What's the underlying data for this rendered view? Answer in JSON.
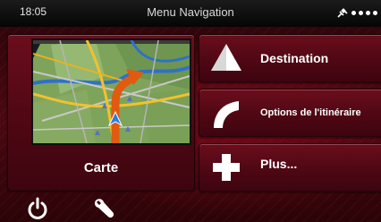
{
  "status": {
    "time": "18:05",
    "title": "Menu Navigation",
    "icons": [
      "satellite-icon",
      "signal-dots-icon"
    ]
  },
  "menu": {
    "map_label": "Carte",
    "destination_label": "Destination",
    "route_options_label": "Options de l'itinéraire",
    "more_label": "Plus..."
  },
  "footer": {
    "icons": [
      "power-icon",
      "wrench-icon"
    ]
  },
  "colors": {
    "accent_red": "#6b0d1c",
    "background_dark": "#2a0408",
    "route_orange": "#e05a10",
    "map_green": "#8fb06a"
  }
}
